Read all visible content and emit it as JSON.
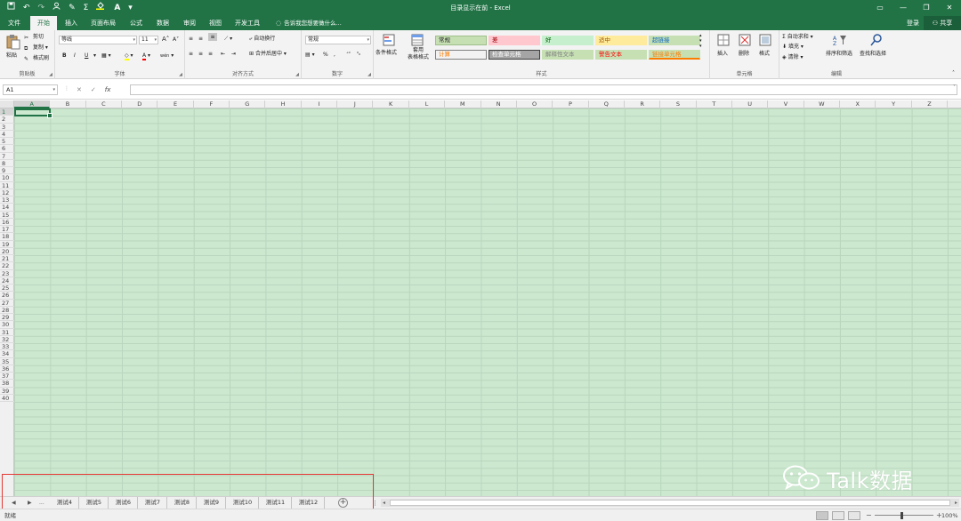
{
  "window": {
    "title": "目录显示在前 - Excel",
    "controls": [
      "—",
      "❐",
      "—",
      "✕"
    ]
  },
  "qat": {
    "icons": [
      "save-icon",
      "undo-icon",
      "redo-icon",
      "person-icon",
      "format-painter-icon",
      "sum-icon",
      "fill-color-icon",
      "font-color-icon",
      "customize-icon"
    ]
  },
  "tabs": [
    "文件",
    "开始",
    "插入",
    "页面布局",
    "公式",
    "数据",
    "审阅",
    "视图",
    "开发工具"
  ],
  "active_tab": "开始",
  "tellme": "告诉我您想要做什么...",
  "account": {
    "login": "登录",
    "share": "共享"
  },
  "ribbon": {
    "clipboard": {
      "label": "剪贴板",
      "paste": "粘贴",
      "cut": "剪切",
      "copy": "复制",
      "format_painter": "格式刷"
    },
    "font": {
      "label": "字体",
      "font_name": "等线",
      "font_size": "11",
      "bold": "B",
      "italic": "I",
      "underline": "U",
      "grow": "A",
      "shrink": "A",
      "font_color": "A",
      "wen": "wén"
    },
    "alignment": {
      "label": "对齐方式",
      "wrap": "自动换行",
      "merge": "合并后居中"
    },
    "number": {
      "label": "数字",
      "format": "常规",
      "percent": "%",
      "comma": ","
    },
    "styles": {
      "label": "样式",
      "cond_format": "条件格式",
      "table_format": "套用\n表格格式",
      "cells": [
        {
          "text": "常规",
          "bg": "#c6e0b4",
          "fg": "#222",
          "border": "#9fbf8a"
        },
        {
          "text": "差",
          "bg": "#ffc7ce",
          "fg": "#9c0006",
          "border": "#ffc7ce"
        },
        {
          "text": "好",
          "bg": "#c6efce",
          "fg": "#006100",
          "border": "#c6efce"
        },
        {
          "text": "适中",
          "bg": "#ffeb9c",
          "fg": "#9c5700",
          "border": "#ffeb9c"
        },
        {
          "text": "超链接",
          "bg": "#c6e0b4",
          "fg": "#0563c1",
          "border": "#c6e0b4"
        },
        {
          "text": "计算",
          "bg": "#f2f2f2",
          "fg": "#fa7d00",
          "border": "#7f7f7f"
        },
        {
          "text": "检查单元格",
          "bg": "#a5a5a5",
          "fg": "#ffffff",
          "border": "#3f3f3f"
        },
        {
          "text": "解释性文本",
          "bg": "#c6e0b4",
          "fg": "#7f7f7f",
          "border": "#c6e0b4"
        },
        {
          "text": "警告文本",
          "bg": "#c6e0b4",
          "fg": "#ff0000",
          "border": "#c6e0b4"
        },
        {
          "text": "链接单元格",
          "bg": "#c6e0b4",
          "fg": "#fa7d00",
          "border": "#c6e0b4"
        }
      ]
    },
    "cells": {
      "label": "单元格",
      "insert": "插入",
      "delete": "删除",
      "format": "格式"
    },
    "editing": {
      "label": "编辑",
      "autosum": "自动求和",
      "fill": "填充",
      "clear": "清除",
      "sort_filter": "排序和筛选",
      "find_select": "查找和选择"
    }
  },
  "formula_bar": {
    "name_box": "A1",
    "fx": "fx",
    "cancel": "✕",
    "enter": "✓",
    "value": ""
  },
  "grid": {
    "columns": [
      "A",
      "B",
      "C",
      "D",
      "E",
      "F",
      "G",
      "H",
      "I",
      "J",
      "K",
      "L",
      "M",
      "N",
      "O",
      "P",
      "Q",
      "R",
      "S",
      "T",
      "U",
      "V",
      "W",
      "X",
      "Y",
      "Z"
    ],
    "rows": [
      "1",
      "2",
      "3",
      "4",
      "5",
      "6",
      "7",
      "8",
      "9",
      "10",
      "11",
      "12",
      "13",
      "14",
      "15",
      "16",
      "17",
      "18",
      "19",
      "20",
      "21",
      "22",
      "23",
      "24",
      "25",
      "26",
      "27",
      "28",
      "29",
      "30",
      "31",
      "32",
      "33",
      "34",
      "35",
      "36",
      "37",
      "38",
      "39",
      "40"
    ],
    "selected_cell": "A1",
    "background": "#cce8cf",
    "gridline": "#b9d6bd"
  },
  "sheet_tabs": {
    "nav": [
      "◀",
      "▶",
      "..."
    ],
    "tabs": [
      "测试4",
      "测试5",
      "测试6",
      "测试7",
      "测试8",
      "测试9",
      "测试10",
      "测试11",
      "测试12"
    ],
    "add": "+"
  },
  "status": {
    "ready": "就绪",
    "zoom": "100%",
    "zoom_minus": "−",
    "zoom_plus": "+"
  },
  "watermark": {
    "text": "Talk数据"
  },
  "highlight": {
    "color": "#e53935"
  }
}
